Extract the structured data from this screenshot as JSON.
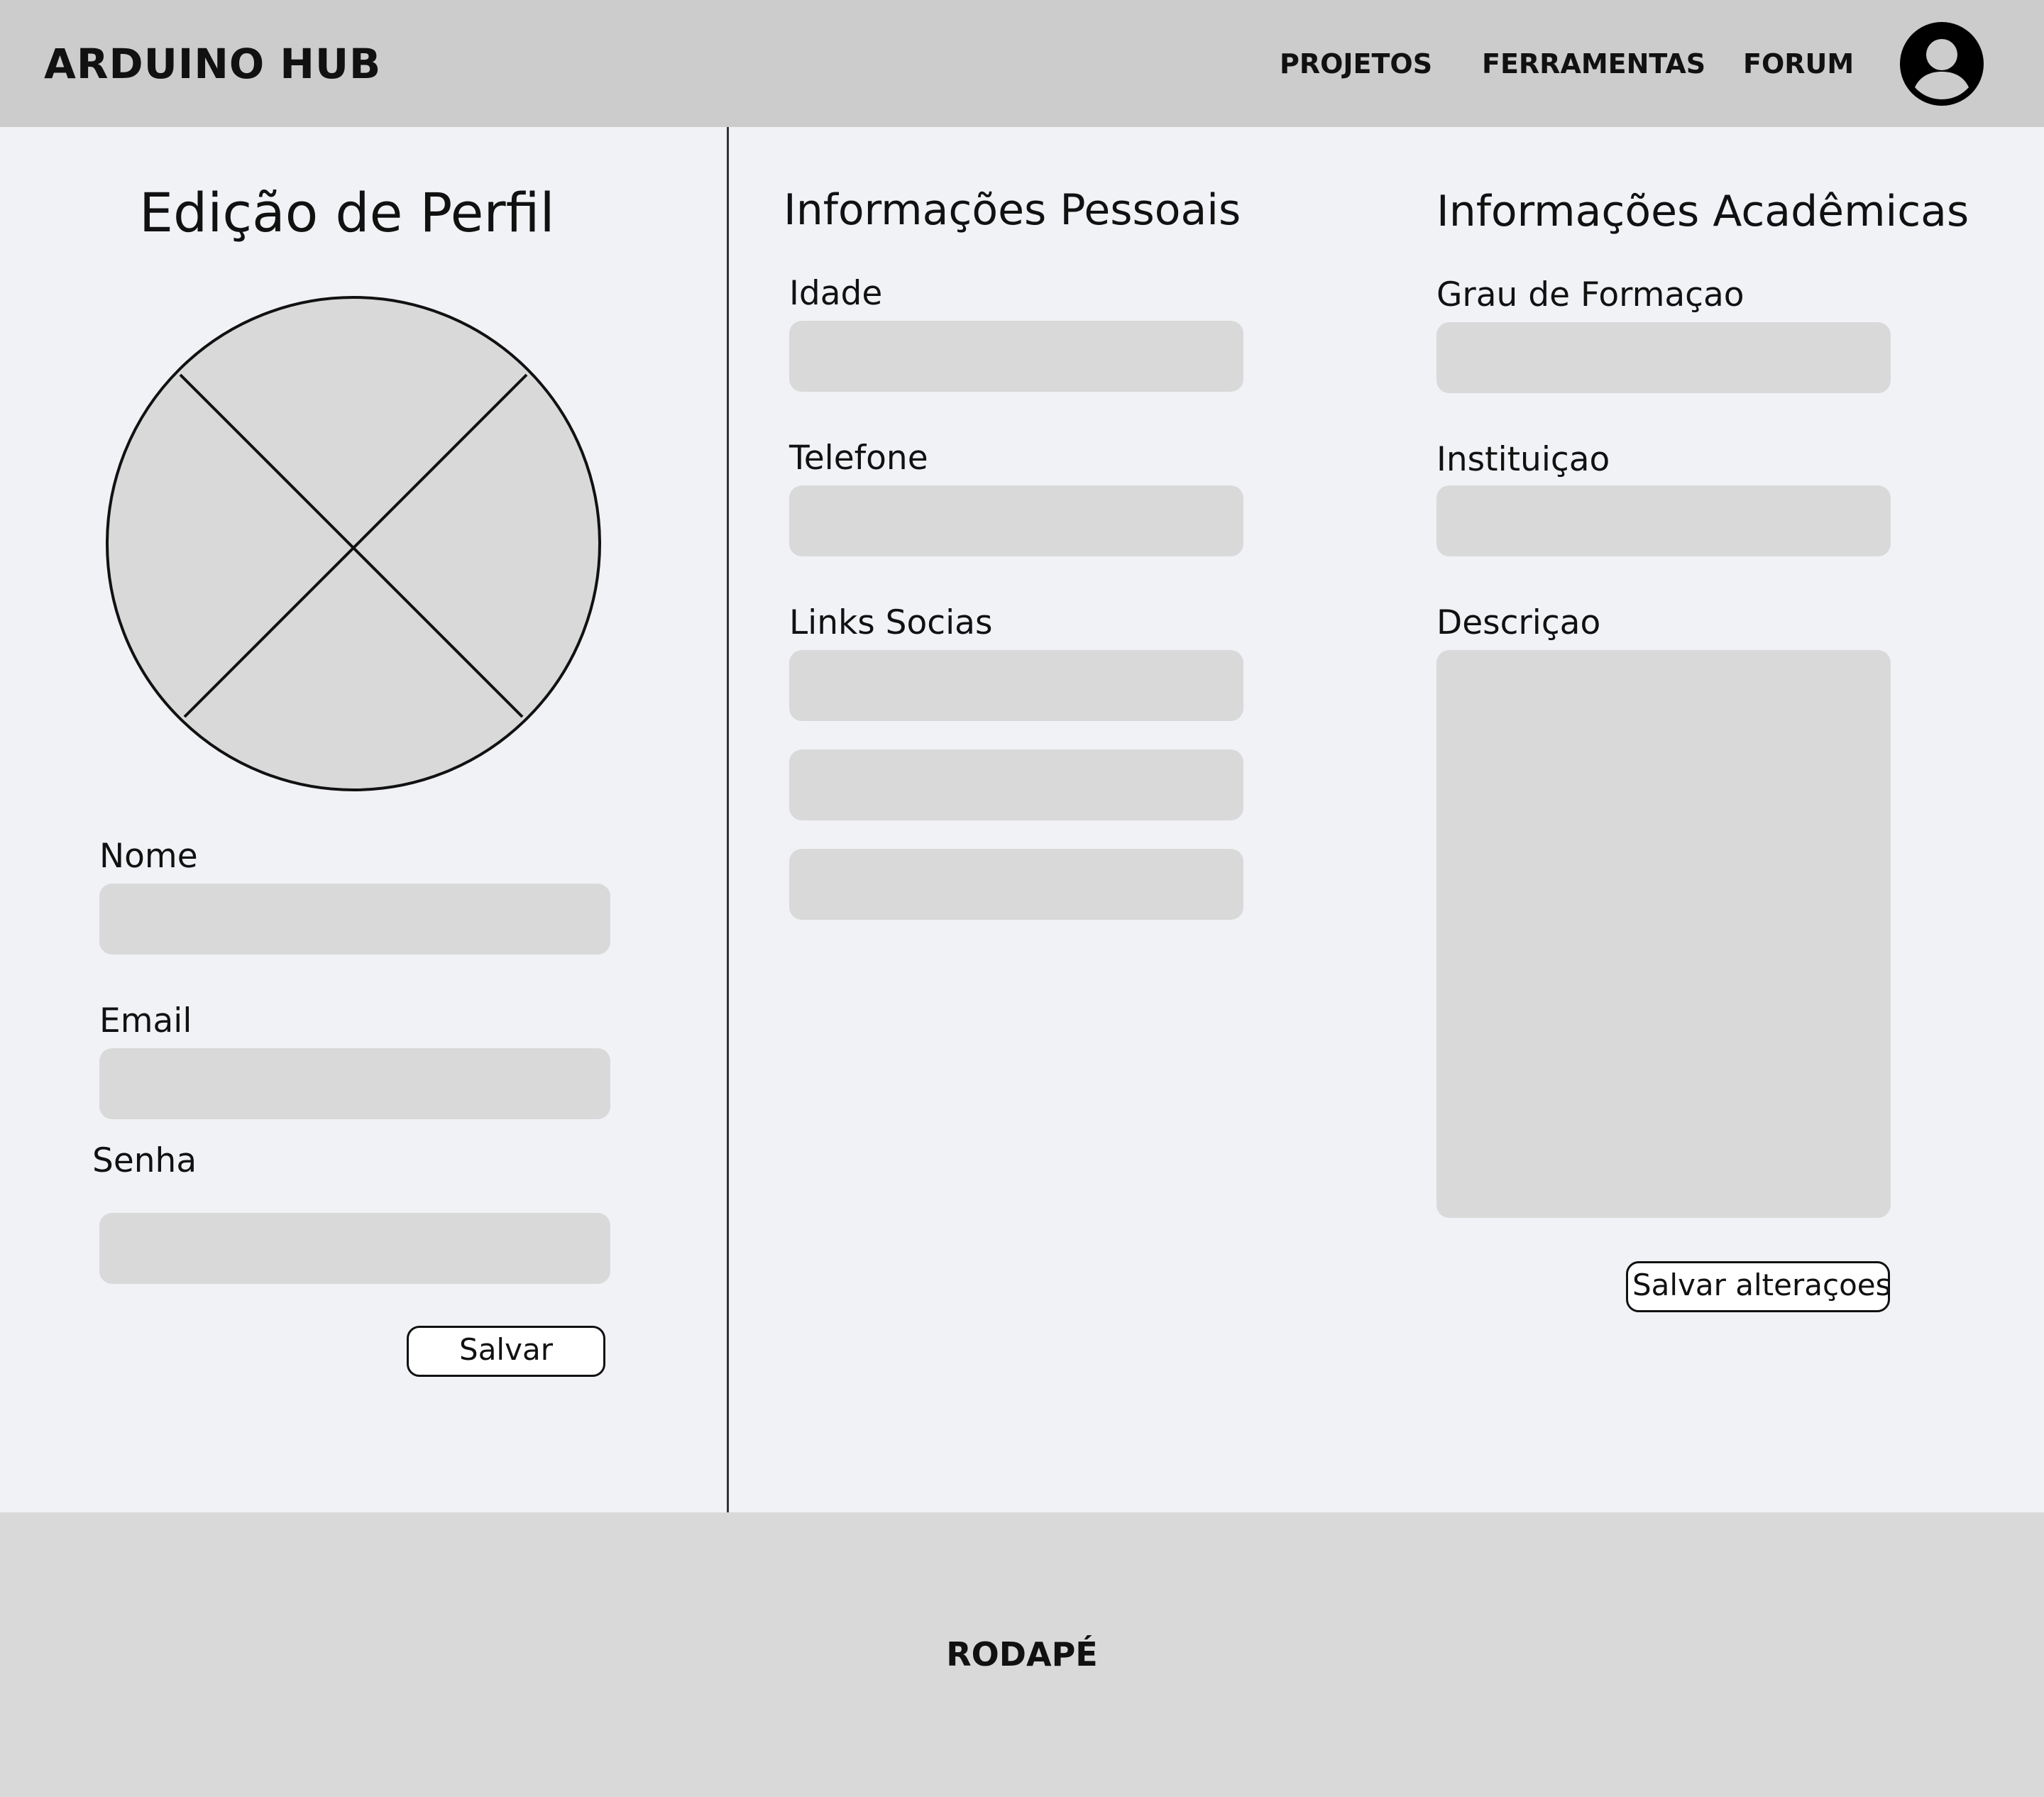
{
  "header": {
    "logo": "ARDUINO HUB",
    "nav": {
      "projetos": "PROJETOS",
      "ferramentas": "FERRAMENTAS",
      "forum": "FORUM"
    },
    "avatar_icon": "user-avatar-icon"
  },
  "profile": {
    "title": "Edição de Perfil",
    "photo_icon": "image-placeholder-icon",
    "fields": {
      "nome": {
        "label": "Nome",
        "value": ""
      },
      "email": {
        "label": "Email",
        "value": ""
      },
      "senha": {
        "label": "Senha",
        "value": ""
      }
    },
    "save_label": "Salvar"
  },
  "personal": {
    "title": "Informações Pessoais",
    "fields": {
      "idade": {
        "label": "Idade",
        "value": ""
      },
      "telefone": {
        "label": "Telefone",
        "value": ""
      },
      "links": {
        "label": "Links Socias",
        "values": [
          "",
          "",
          ""
        ]
      }
    }
  },
  "academic": {
    "title": "Informações Acadêmicas",
    "fields": {
      "grau": {
        "label": "Grau de Formaçao",
        "value": ""
      },
      "instituicao": {
        "label": "Instituiçao",
        "value": ""
      },
      "descricao": {
        "label": "Descriçao",
        "value": ""
      }
    },
    "save_label": "Salvar alteraçoes"
  },
  "footer": {
    "text": "RODAPÉ"
  },
  "colors": {
    "header_bg": "#cccccc",
    "page_bg": "#f1f2f6",
    "field_bg": "#d9d9d9",
    "footer_bg": "#d9d9d9"
  }
}
